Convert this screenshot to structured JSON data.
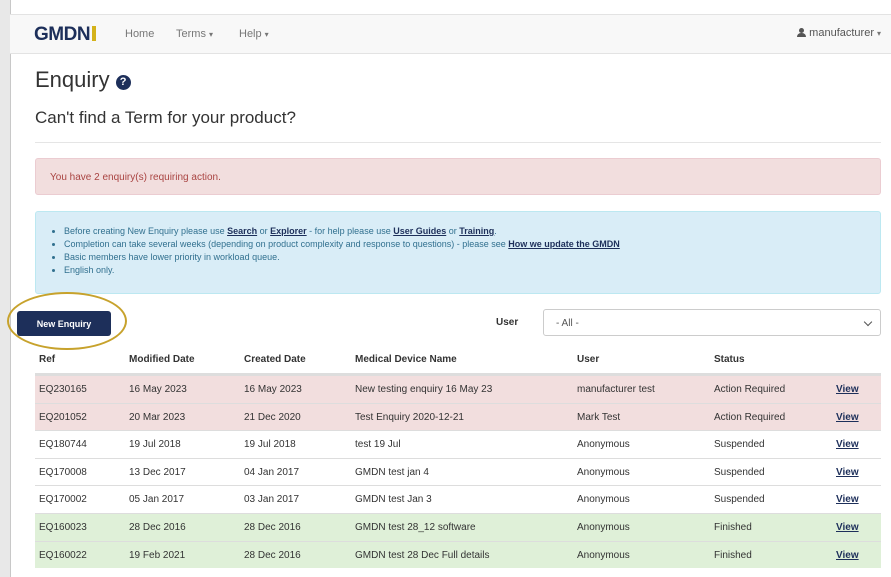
{
  "navbar": {
    "brand": "GMDN",
    "items": [
      {
        "label": "Home",
        "has_caret": false
      },
      {
        "label": "Terms",
        "has_caret": true
      },
      {
        "label": "Help",
        "has_caret": true
      }
    ],
    "user_label": "manufacturer"
  },
  "header": {
    "title": "Enquiry",
    "subtitle": "Can't find a Term for your product?"
  },
  "alerts": {
    "action_message": "You have 2 enquiry(s) requiring action.",
    "info": {
      "line1_a": "Before creating New Enquiry please use ",
      "link_search": "Search",
      "line1_b": " or ",
      "link_explorer": "Explorer",
      "line1_c": " - for help please use ",
      "link_guides": "User Guides",
      "line1_d": " or ",
      "link_training": "Training",
      "line1_e": ".",
      "line2_a": "Completion can take several weeks (depending on product complexity and response to questions) - please see ",
      "link_update": "How we update the GMDN",
      "line3": "Basic members have lower priority in workload queue.",
      "line4": "English only."
    }
  },
  "toolbar": {
    "new_enquiry_label": "New Enquiry",
    "user_filter_label": "User",
    "user_filter_value": "- All -"
  },
  "table": {
    "columns": [
      "Ref",
      "Modified Date",
      "Created Date",
      "Medical Device Name",
      "User",
      "Status",
      ""
    ],
    "rows": [
      {
        "ref": "EQ230165",
        "modified": "16 May 2023",
        "created": "16 May 2023",
        "name": "New testing enquiry 16 May 23",
        "user": "manufacturer test",
        "status": "Action Required",
        "link": "View",
        "state": "danger"
      },
      {
        "ref": "EQ201052",
        "modified": "20 Mar 2023",
        "created": "21 Dec 2020",
        "name": "Test Enquiry 2020-12-21",
        "user": "Mark Test",
        "status": "Action Required",
        "link": "View",
        "state": "danger"
      },
      {
        "ref": "EQ180744",
        "modified": "19 Jul 2018",
        "created": "19 Jul 2018",
        "name": "test 19 Jul",
        "user": "Anonymous",
        "status": "Suspended",
        "link": "View",
        "state": "default"
      },
      {
        "ref": "EQ170008",
        "modified": "13 Dec 2017",
        "created": "04 Jan 2017",
        "name": "GMDN test jan 4",
        "user": "Anonymous",
        "status": "Suspended",
        "link": "View",
        "state": "default"
      },
      {
        "ref": "EQ170002",
        "modified": "05 Jan 2017",
        "created": "03 Jan 2017",
        "name": "GMDN test Jan 3",
        "user": "Anonymous",
        "status": "Suspended",
        "link": "View",
        "state": "default"
      },
      {
        "ref": "EQ160023",
        "modified": "28 Dec 2016",
        "created": "28 Dec 2016",
        "name": "GMDN test 28_12 software",
        "user": "Anonymous",
        "status": "Finished",
        "link": "View",
        "state": "success"
      },
      {
        "ref": "EQ160022",
        "modified": "19 Feb 2021",
        "created": "28 Dec 2016",
        "name": "GMDN test 28 Dec Full details",
        "user": "Anonymous",
        "status": "Finished",
        "link": "View",
        "state": "success"
      }
    ]
  },
  "colors": {
    "brand_navy": "#1d2f5a",
    "brand_gold": "#d4b21a",
    "highlight_ring": "#c7a22c",
    "row_danger": "#f2dede",
    "row_success": "#dff0d8"
  }
}
